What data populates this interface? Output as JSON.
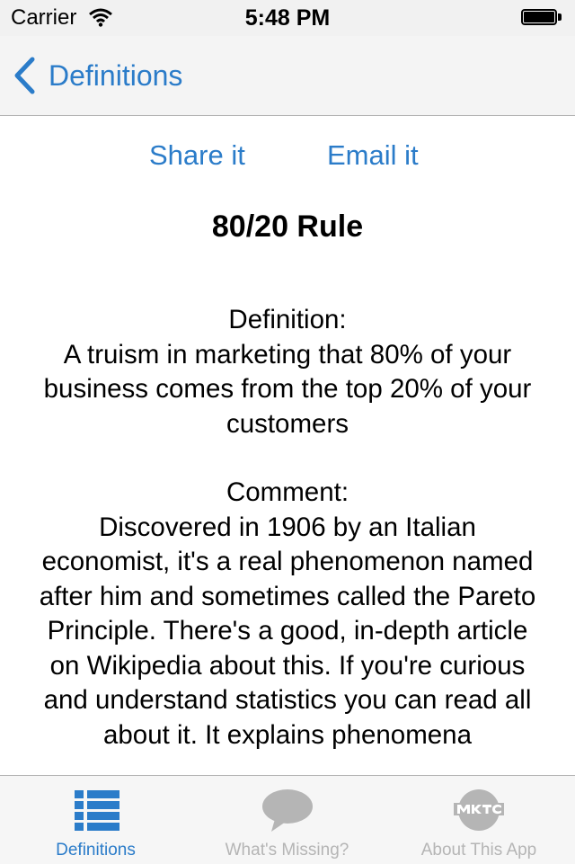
{
  "status_bar": {
    "carrier": "Carrier",
    "time": "5:48 PM"
  },
  "nav": {
    "back_label": "Definitions"
  },
  "actions": {
    "share_label": "Share it",
    "email_label": "Email it"
  },
  "term": {
    "title": "80/20 Rule",
    "definition_heading": "Definition:",
    "definition_text": "A truism in marketing that 80% of your business comes from the top 20% of your customers",
    "comment_heading": "Comment:",
    "comment_text": "Discovered in 1906 by an Italian economist, it's a real phenomenon named after him and sometimes called the Pareto Principle. There's a good, in-depth article on Wikipedia about this. If you're curious and understand statistics you can read all about it. It explains phenomena"
  },
  "tab_bar": {
    "tabs": [
      {
        "label": "Definitions",
        "icon": "list-icon",
        "active": true
      },
      {
        "label": "What's Missing?",
        "icon": "speech-bubble-icon",
        "active": false
      },
      {
        "label": "About This App",
        "icon": "mktc-logo-icon",
        "active": false
      }
    ]
  },
  "colors": {
    "accent": "#2b7cc9",
    "inactive": "#b5b5b5"
  }
}
